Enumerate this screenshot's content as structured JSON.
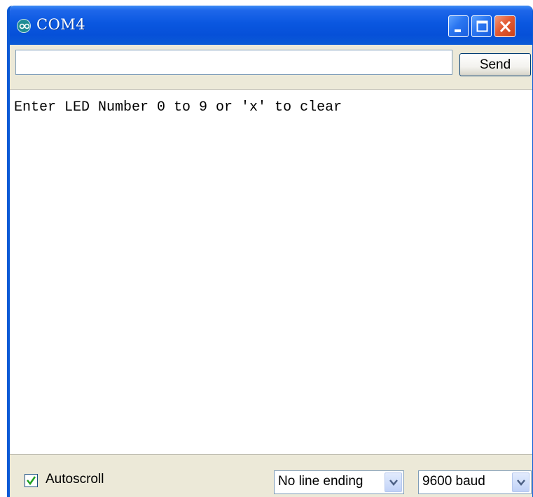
{
  "window": {
    "title": "COM4",
    "icon": "arduino-infinity-icon",
    "controls": [
      "minimize-icon",
      "maximize-icon",
      "close-icon"
    ]
  },
  "send": {
    "input_value": "",
    "button_label": "Send"
  },
  "output": {
    "lines": [
      "Enter LED Number 0 to 9 or 'x' to clear"
    ]
  },
  "status": {
    "autoscroll_label": "Autoscroll",
    "autoscroll_checked": true,
    "line_ending_selected": "No line ending",
    "baud_selected": "9600 baud"
  },
  "colors": {
    "titlebar": "#0a57e0",
    "window_bg": "#ece9d8",
    "close_button": "#e35a33"
  }
}
